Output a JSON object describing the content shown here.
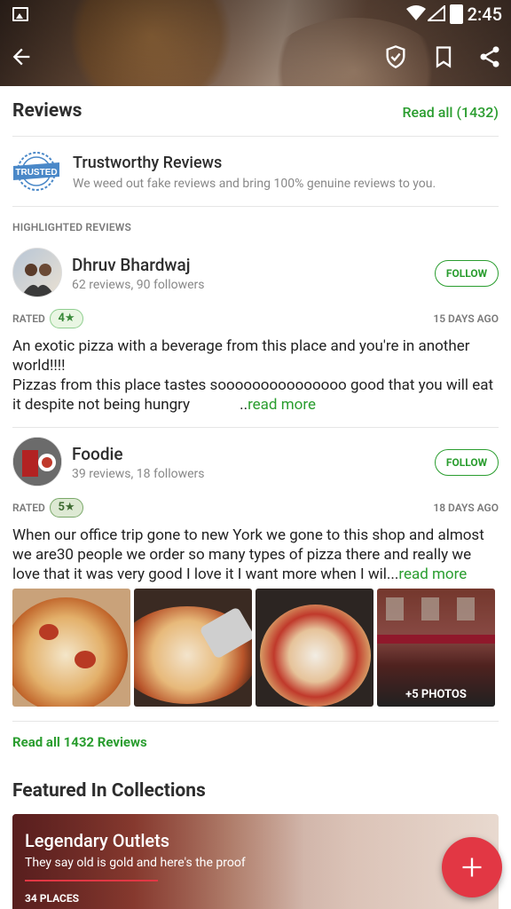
{
  "status_bar": {
    "time": "2:45"
  },
  "reviews_section": {
    "title": "Reviews",
    "read_all_link": "Read all (1432)",
    "trust": {
      "badge_text": "TRUSTED",
      "title": "Trustworthy Reviews",
      "subtitle": "We weed out fake reviews and bring 100% genuine reviews to you."
    },
    "highlighted_caption": "HIGHLIGHTED REVIEWS",
    "reviews": [
      {
        "name": "Dhruv Bhardwaj",
        "meta": "62 reviews, 90 followers",
        "follow_label": "FOLLOW",
        "rated_label": "RATED",
        "rating": "4★",
        "age": "15 DAYS AGO",
        "text_line1": "An exotic pizza with a beverage from this place and you're in another world!!!!",
        "text_line2": "Pizzas from this place tastes sooooooooooooooo good that you will eat it despite not being hungry",
        "more_prefix": "..",
        "more_label": "read more"
      },
      {
        "name": "Foodie",
        "meta": "39 reviews, 18 followers",
        "follow_label": "FOLLOW",
        "rated_label": "RATED",
        "rating": "5★",
        "age": "18 DAYS AGO",
        "text": "When our office trip gone to new York we gone to this shop and almost we are30 people we order so many types of pizza there and really we love that      it was very good I love it I want more when I wil...",
        "more_label": "read more",
        "more_photos_label": "+5 PHOTOS"
      }
    ],
    "read_all_bottom": "Read all 1432 Reviews"
  },
  "featured": {
    "title": "Featured In Collections",
    "collection": {
      "title": "Legendary Outlets",
      "subtitle": "They say old is gold and here's the proof",
      "count": "34 PLACES"
    }
  },
  "colors": {
    "accent_green": "#2a9d2f",
    "fab_red": "#e23744"
  }
}
